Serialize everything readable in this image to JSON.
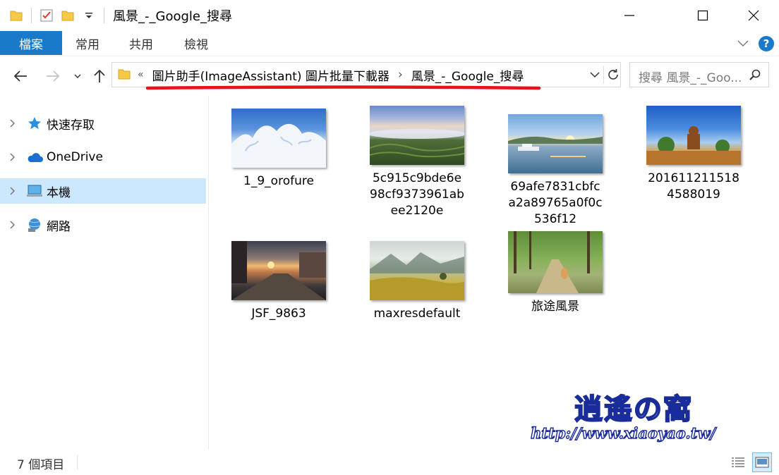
{
  "window": {
    "title": "風景_-_Google_搜尋"
  },
  "ribbon": {
    "tabs": [
      "檔案",
      "常用",
      "共用",
      "檢視"
    ]
  },
  "address": {
    "overflow_glyph": "«",
    "crumbs": [
      "圖片助手(ImageAssistant) 圖片批量下載器",
      "風景_-_Google_搜尋"
    ],
    "separator": "›"
  },
  "search": {
    "placeholder": "搜尋 風景_-_Goo..."
  },
  "sidebar": {
    "items": [
      {
        "label": "快速存取",
        "icon": "star-icon"
      },
      {
        "label": "OneDrive",
        "icon": "cloud-icon"
      },
      {
        "label": "本機",
        "icon": "computer-icon",
        "selected": true
      },
      {
        "label": "網路",
        "icon": "network-icon"
      }
    ]
  },
  "files": [
    {
      "name": "1_9_orofure",
      "thumb": "snowy-trees"
    },
    {
      "name": "5c915c9bde6e98cf9373961abee2120e",
      "thumb": "tea-field-sea-of-clouds"
    },
    {
      "name": "69afe7831cbfca2a89765a0f0c536f12",
      "thumb": "lake-sunset-boats"
    },
    {
      "name": "2016112115184588019",
      "thumb": "buddha-statue-blue-sky"
    },
    {
      "name": "JSF_9863",
      "thumb": "canal-sunset"
    },
    {
      "name": "maxresdefault",
      "thumb": "misty-mountains"
    },
    {
      "name": "旅途風景",
      "thumb": "forest-path-cat"
    }
  ],
  "status": {
    "item_count": "7 個項目"
  },
  "watermark": {
    "logo": "逍遙の窩",
    "url": "http://www.xiaoyao.tw/"
  },
  "colors": {
    "file_tab": "#1979ca",
    "selection": "#cce8ff",
    "help": "#1979ca",
    "annotation": "#e8121b"
  }
}
